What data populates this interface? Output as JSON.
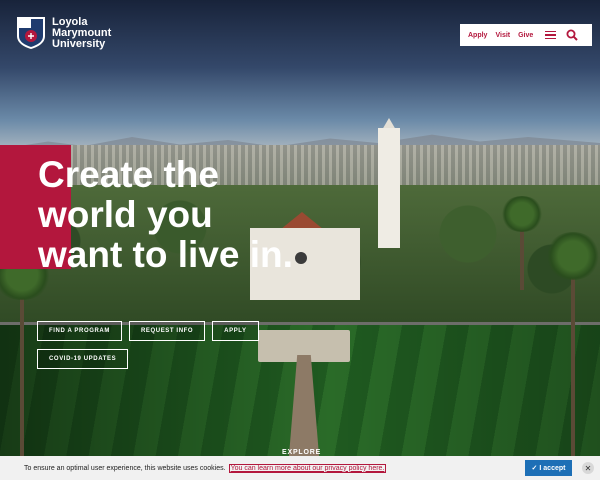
{
  "header": {
    "logo_lines": [
      "Loyola",
      "Marymount",
      "University"
    ],
    "utility_links": [
      "Apply",
      "Visit",
      "Give"
    ],
    "menu_icon": "hamburger-menu-icon",
    "search_icon": "search-icon"
  },
  "hero": {
    "headline_lines": [
      "Create the",
      "world you",
      "want to live in."
    ],
    "buttons": [
      "FIND A PROGRAM",
      "REQUEST INFO",
      "APPLY"
    ],
    "secondary_button": "COVID-19 UPDATES",
    "explore_label": "EXPLORE"
  },
  "cookie_banner": {
    "message": "To ensure an optimal user experience, this website uses cookies.",
    "link_text": "You can learn more about our privacy policy here.",
    "accept_label": "I accept",
    "accept_icon": "checkmark-icon",
    "close_icon": "close-icon"
  },
  "colors": {
    "brand_red": "#b3173d",
    "accept_blue": "#1d6fb6",
    "banner_bg": "#f1f1f1"
  }
}
